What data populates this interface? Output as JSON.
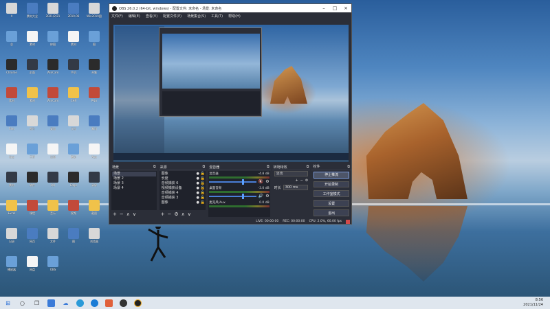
{
  "obs": {
    "title": "OBS 26.0.2 (64-bit, windows) - 配置文件: 未命名 - 场景: 未命名",
    "menu": [
      "文件(F)",
      "编辑(E)",
      "查看(V)",
      "配置文件(P)",
      "场景集合(S)",
      "工具(T)",
      "帮助(H)"
    ],
    "scenes": {
      "title": "场景",
      "items": [
        "场景",
        "场景 2",
        "场景 3",
        "场景 4"
      ]
    },
    "sources": {
      "title": "来源",
      "items": [
        "图像",
        "长度",
        "音频捕获 6",
        "视频捕获设备",
        "音频捕获 4",
        "音频捕获 3",
        "图像"
      ]
    },
    "mixer": {
      "title": "混音器",
      "tracks": [
        {
          "name": "混音器",
          "db": "-4.8 dB"
        },
        {
          "name": "桌面音频",
          "db": "-3.0 dB"
        },
        {
          "name": "麦克风/Aux",
          "db": "0.0 dB"
        }
      ]
    },
    "transitions": {
      "title": "转场特效",
      "selected": "淡出",
      "duration_label": "时长",
      "duration_value": "300 ms"
    },
    "controls": {
      "title": "控件",
      "buttons": [
        "停止推流",
        "开始录制",
        "工作室模式",
        "设置",
        "退出"
      ]
    },
    "status": {
      "live": "LIVE: 00:00:00",
      "rec": "REC: 00:00:00",
      "cpu": "CPU: 2.0%, 60.00 fps"
    }
  },
  "desktop": {
    "icon_labels": [
      "A",
      "素材大全",
      "2021/2/21",
      "2019-06",
      "Win2019图",
      "总",
      "素材",
      "修图",
      "素材",
      "图",
      "Chrome",
      "封面",
      "WinCam",
      "手机",
      "合集",
      "素材",
      "素材",
      "WinCam",
      "CHR",
      "PNG",
      "Files",
      "图片",
      "桌面",
      "文档",
      "腾讯",
      "App",
      "工作",
      "云盘",
      "笔记",
      "App",
      "素材",
      "软件",
      "QQ",
      "Edge",
      "录屏",
      "Excel",
      "课程",
      "音乐",
      "视频",
      "截图",
      "记录",
      "网页",
      "文件",
      "图",
      "浏览器",
      "播放器",
      "网盘",
      "OBS"
    ]
  },
  "taskbar": {
    "time": "8:56",
    "date": "2021/11/24"
  }
}
